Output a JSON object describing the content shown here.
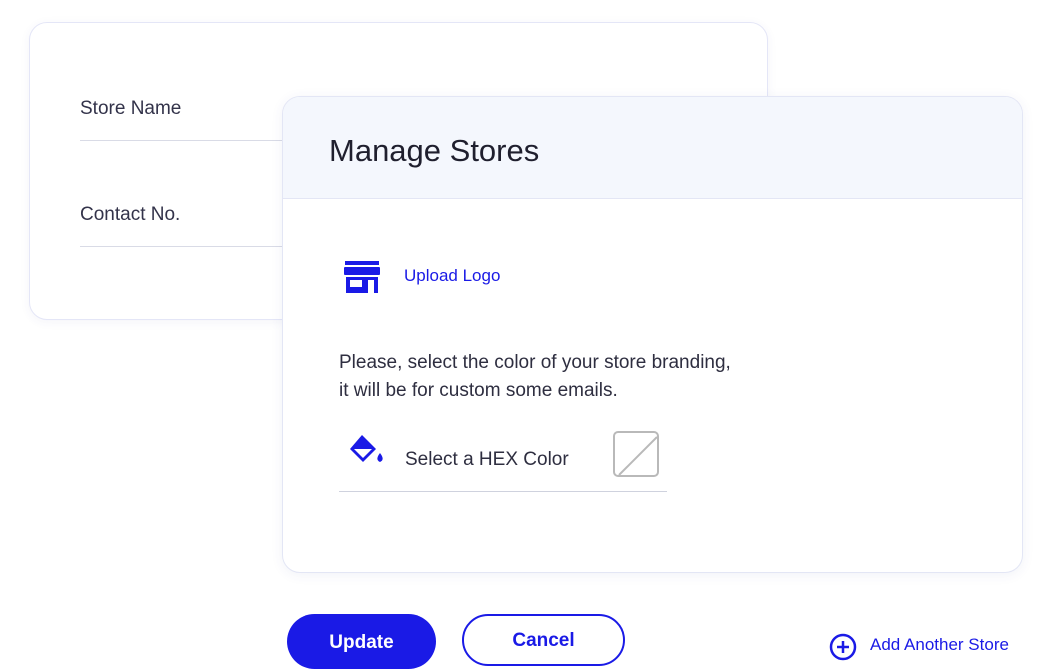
{
  "store_form": {
    "store_name_label": "Store Name",
    "contact_label": "Contact No."
  },
  "modal": {
    "title": "Manage Stores",
    "upload_logo_label": "Upload Logo",
    "description_line1": "Please, select the color of your  store branding,",
    "description_line2": "it will be for custom some emails.",
    "color_field_label": "Select a HEX Color",
    "icons": [
      "store-icon",
      "paint-bucket-icon",
      "empty-color-swatch"
    ]
  },
  "actions": {
    "update_label": "Update",
    "cancel_label": "Cancel",
    "add_store_label": "Add Another Store"
  },
  "colors": {
    "accent": "#1a1ae6",
    "header_bg": "#f4f7fd",
    "border": "#e3e6f5"
  }
}
